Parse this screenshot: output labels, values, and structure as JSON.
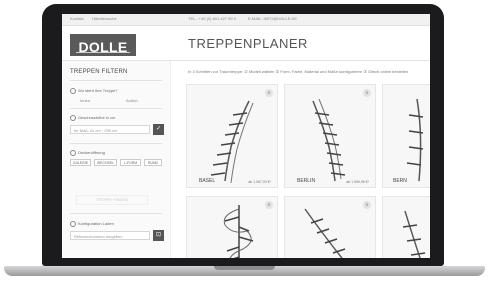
{
  "topbar": {
    "links": [
      "Kontakt",
      "Händlersuche"
    ],
    "phone": "TEL.: +49 (0) 601 427 99 0",
    "email": "E-MAIL: INFO@DOLLE.DE"
  },
  "brand": {
    "logo_text": "DOLLE"
  },
  "page": {
    "title": "TREPPENPLANER"
  },
  "sidebar": {
    "title": "TREPPEN FILTERN",
    "q1": {
      "label": "Wo steht Ihre Treppe?",
      "options": [
        "Innen",
        "Außen"
      ]
    },
    "q2": {
      "label": "Geschosshöhe in cm",
      "placeholder": "Ihr Maß: 0x cm - 299 cm",
      "button": "✓"
    },
    "q3": {
      "label": "Deckenöffnung",
      "options": [
        "GALERIE",
        "WECHSEL",
        "L-FORM",
        "RUND"
      ]
    },
    "ghost_button": "TREPPE FINDEN",
    "q4": {
      "label": "Konfiguration Laden",
      "placeholder": "Referenznummer eingeben",
      "button": "⊡"
    }
  },
  "intro_text": "In 3 Schritten zur Traumtreppe:  ① Modell wählen  ② Form, Farbe, Material und Maße konfigurieren  ③ Gleich online bestellen",
  "products": [
    {
      "name": "BASEL",
      "price": "ab 1.067,00 €*"
    },
    {
      "name": "BERLIN",
      "price": "ab 1.959,95 €*"
    },
    {
      "name": "BERN",
      "price": ""
    },
    {
      "name": "",
      "price": ""
    },
    {
      "name": "",
      "price": ""
    },
    {
      "name": "",
      "price": ""
    }
  ]
}
